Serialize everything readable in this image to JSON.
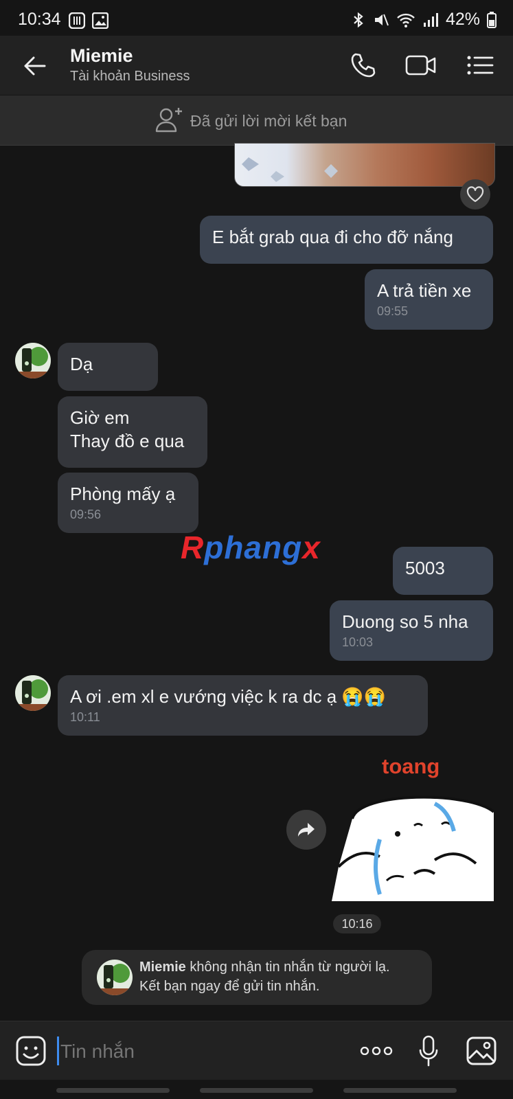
{
  "status": {
    "time": "10:34",
    "battery": "42%"
  },
  "header": {
    "name": "Miemie",
    "subtitle": "Tài khoản Business"
  },
  "friend_bar": {
    "text": "Đã gửi lời mời kết bạn"
  },
  "messages": [
    {
      "text": "E bắt grab qua đi cho đỡ nắng"
    },
    {
      "text": "A trả tiền xe",
      "time": "09:55"
    },
    {
      "text": "Dạ"
    },
    {
      "line1": "Giờ em",
      "line2": "Thay đồ e qua"
    },
    {
      "text": "Phòng mấy ạ",
      "time": "09:56"
    },
    {
      "text": "5003"
    },
    {
      "text": "Duong so 5 nha",
      "time": "10:03"
    },
    {
      "text": "A ơi .em xl e vướng việc k ra dc ạ 😭😭",
      "time": "10:11"
    }
  ],
  "sticker": {
    "caption": "toang",
    "time": "10:16"
  },
  "watermark": {
    "prefix": "R",
    "main": "phang",
    "suffix": "x"
  },
  "system_notice": {
    "name": "Miemie",
    "line1_rest": " không nhận tin nhắn từ người lạ.",
    "line2": "Kết bạn ngay để gửi tin nhắn."
  },
  "input": {
    "placeholder": "Tin nhắn"
  },
  "icons": [
    "back-arrow-icon",
    "phone-icon",
    "video-call-icon",
    "menu-list-icon",
    "add-friend-icon",
    "heart-icon",
    "share-icon",
    "sticker-emoji-icon",
    "more-icon",
    "microphone-icon",
    "image-icon"
  ]
}
